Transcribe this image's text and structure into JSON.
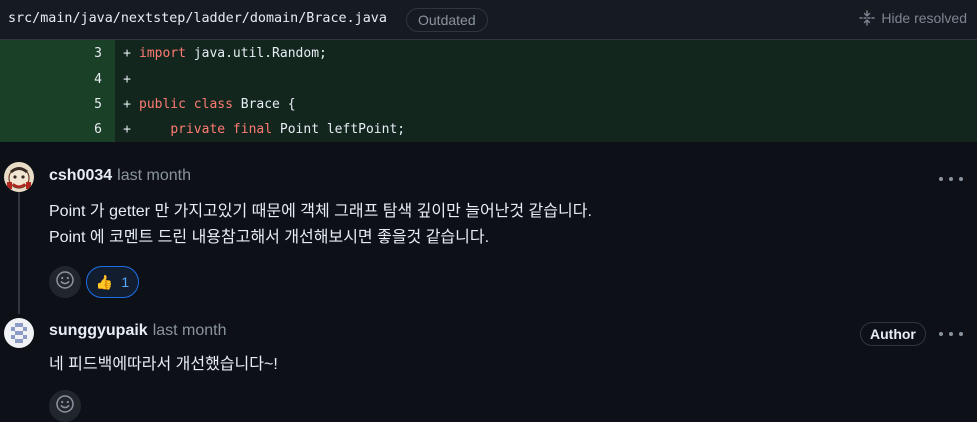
{
  "file": {
    "path": "src/main/java/nextstep/ladder/domain/Brace.java",
    "status_badge": "Outdated",
    "hide_resolved_label": "Hide resolved"
  },
  "diff": {
    "lines": [
      {
        "number": "3",
        "sign": "+",
        "keyword": "import",
        "rest": " java.util.Random;"
      },
      {
        "number": "4",
        "sign": "+",
        "keyword": "",
        "rest": ""
      },
      {
        "number": "5",
        "sign": "+",
        "keyword": "public class",
        "rest": " Brace {"
      },
      {
        "number": "6",
        "sign": "+",
        "indent": "    ",
        "keyword": "private final",
        "rest": " Point leftPoint;"
      }
    ]
  },
  "comments": [
    {
      "author": "csh0034",
      "time": "last month",
      "body": [
        "Point 가 getter 만 가지고있기 때문에 객체 그래프 탐색 깊이만 늘어난것 같습니다.",
        "Point 에 코멘트 드린 내용참고해서 개선해보시면 좋을것 같습니다."
      ],
      "reaction": {
        "emoji": "👍",
        "count": "1"
      }
    },
    {
      "author": "sunggyupaik",
      "time": "last month",
      "badge": "Author",
      "body": [
        "네 피드백에따라서 개선했습니다~!"
      ]
    }
  ],
  "icons": {
    "hide_resolved": "fold-icon",
    "more": "kebab-horizontal-icon",
    "add_reaction": "smiley-icon"
  },
  "colors": {
    "background": "#0d1117",
    "header": "#161b22",
    "diff_added": "#12261e",
    "diff_gutter": "#1a4027",
    "keyword": "#ff7b72",
    "reaction_border": "#1f6feb"
  }
}
